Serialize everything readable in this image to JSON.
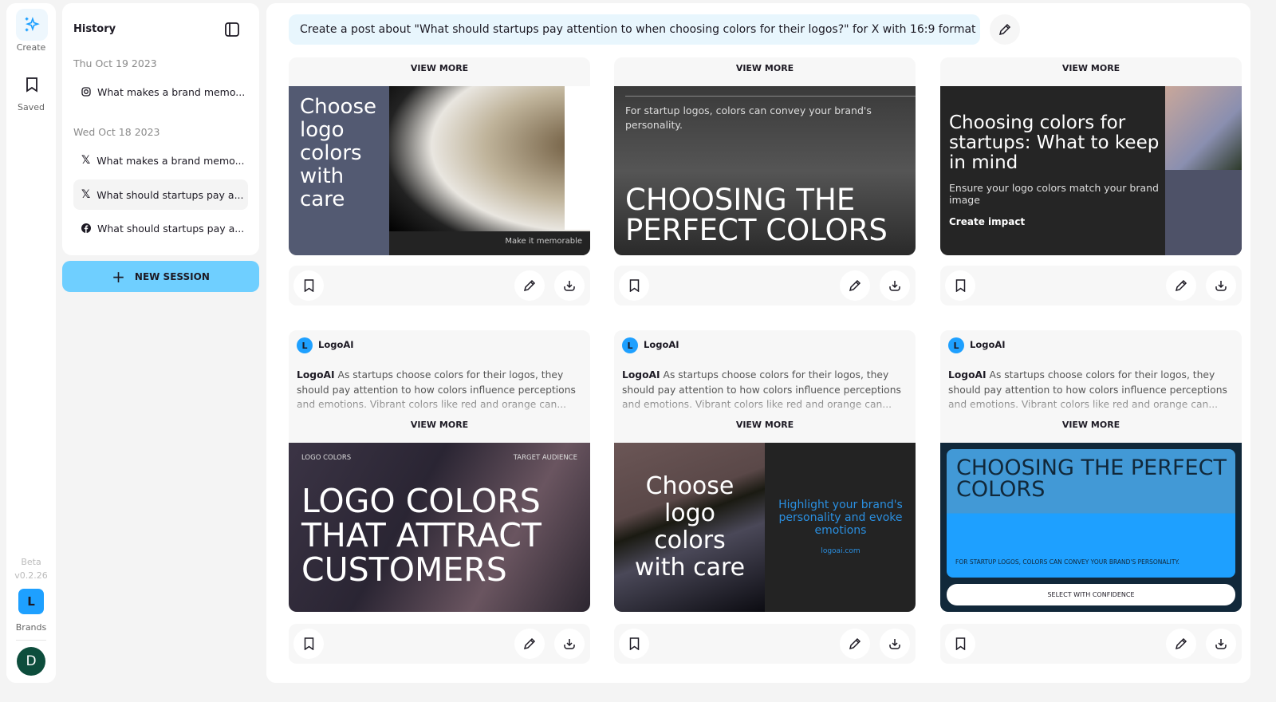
{
  "rail": {
    "create": "Create",
    "saved": "Saved",
    "beta": "Beta",
    "version": "v0.2.26",
    "brand_initial": "L",
    "brands": "Brands",
    "user_initial": "D"
  },
  "history": {
    "title": "History",
    "groups": [
      {
        "date": "Thu Oct 19 2023",
        "items": [
          {
            "platform": "instagram",
            "label": "What makes a brand memo..."
          }
        ]
      },
      {
        "date": "Wed Oct 18 2023",
        "items": [
          {
            "platform": "x",
            "label": "What makes a brand memo..."
          },
          {
            "platform": "x",
            "label": "What should startups pay a...",
            "active": true
          },
          {
            "platform": "facebook",
            "label": "What should startups pay a..."
          }
        ]
      }
    ],
    "new_session": "NEW SESSION"
  },
  "prompt": "Create a post about \"What should startups pay attention to when choosing colors for their logos?\" for X with 16:9 format",
  "view_more": "VIEW MORE",
  "post": {
    "author": "LogoAI",
    "initial": "L",
    "lead": "LogoAI",
    "text": " As startups choose colors for their logos, they should pay attention to how colors influence perceptions and emotions. Vibrant colors like red and orange can..."
  },
  "cards": [
    {
      "headline": "Choose logo colors with care",
      "footer": "Make it memorable"
    },
    {
      "sub": "For startup logos, colors can convey your brand's personality.",
      "headline": "CHOOSING THE PERFECT COLORS"
    },
    {
      "headline": "Choosing colors for startups: What to keep in mind",
      "sub": "Ensure your logo colors match your brand image",
      "cta": "Create impact"
    },
    {
      "tag_left": "LOGO COLORS",
      "tag_right": "TARGET AUDIENCE",
      "headline": "LOGO COLORS THAT ATTRACT CUSTOMERS"
    },
    {
      "headline": "Choose logo colors with care",
      "sub": "Highlight your brand's personality and evoke emotions",
      "url": "logoai.com"
    },
    {
      "headline": "CHOOSING THE PERFECT COLORS",
      "sub": "FOR STARTUP LOGOS, COLORS CAN CONVEY YOUR BRAND'S PERSONALITY.",
      "cta": "SELECT WITH CONFIDENCE"
    }
  ],
  "colors": {
    "accent": "#1ea0ff",
    "new_session": "#6fcfff",
    "prompt_bg": "#e8f6fd",
    "avatar": "#0d4d3c"
  }
}
